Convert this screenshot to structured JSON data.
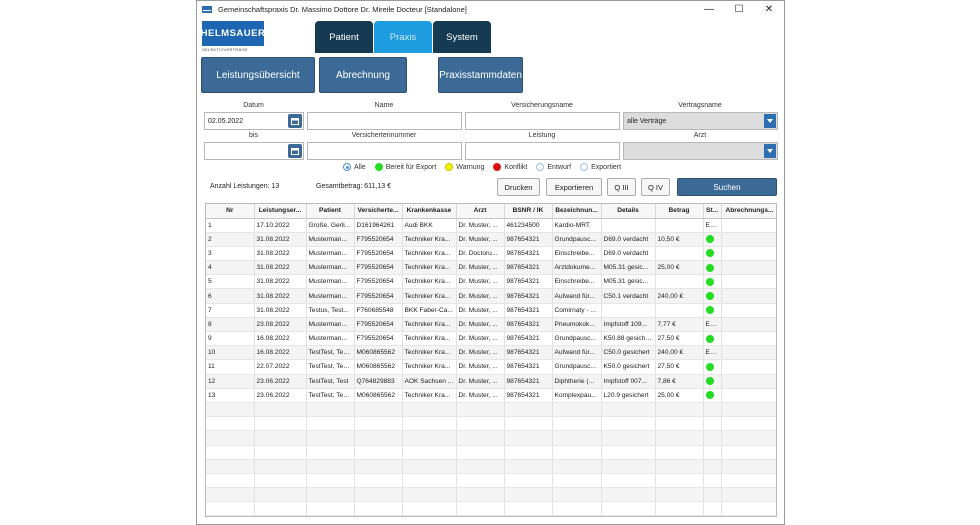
{
  "window": {
    "title": "Gemeinschaftspraxis Dr. Massimo Dottore Dr. Mireile Docteur  [Standalone]",
    "minimize": "—",
    "maximize": "☐",
    "close": "✕"
  },
  "logo": {
    "text": "HELMSAUER",
    "subtitle": "SELEKTIVVERTRÄGE"
  },
  "tabs": [
    {
      "label": "Patient"
    },
    {
      "label": "Praxis"
    },
    {
      "label": "System"
    }
  ],
  "subtabs": [
    {
      "label": "Leistungsübersicht"
    },
    {
      "label": "Abrechnung"
    },
    {
      "label": "Praxisstammdaten"
    }
  ],
  "filters": {
    "datum_label": "Datum",
    "datum_value": "02.05.2022",
    "bis_label": "bis",
    "bis_value": "",
    "name_label": "Name",
    "versichertennummer_label": "Versichertennummer",
    "versicherungsname_label": "Versicherungsname",
    "leistung_label": "Leistung",
    "vertragsname_label": "Vertragsname",
    "vertragsname_value": "alle Verträge",
    "arzt_label": "Arzt",
    "arzt_value": ""
  },
  "status_filter": {
    "options": [
      {
        "label": "Alle",
        "color": ""
      },
      {
        "label": "Bereit für Export",
        "color": "#22dd22"
      },
      {
        "label": "Warnung",
        "color": "#f2f200"
      },
      {
        "label": "Konflikt",
        "color": "#dd1111"
      },
      {
        "label": "Entwurf",
        "color": ""
      },
      {
        "label": "Exportiert",
        "color": ""
      }
    ],
    "selected": "Alle"
  },
  "summary": {
    "count": "Anzahl Leistungen: 13",
    "total": "Gesamtbetrag: 611,13 €"
  },
  "actions": {
    "drucken": "Drucken",
    "exportieren": "Exportieren",
    "q3": "Q III",
    "q4": "Q IV",
    "suchen": "Suchen"
  },
  "table": {
    "columns": [
      "Nr",
      "Leistungser...",
      "Patient",
      "Versicherte...",
      "Krankenkasse",
      "Arzt",
      "BSNR / IK",
      "Bezeichnun...",
      "Details",
      "Betrag",
      "St...",
      "Abrechnungs..."
    ],
    "rows": [
      {
        "nr": "1",
        "datum": "17.10.2022",
        "patient": "Große, Gerli...",
        "vnr": "D161964261",
        "kasse": "Audi BKK",
        "arzt": "Dr. Muster, ...",
        "bsnr": "461234500",
        "bez": "Kardio-MRT",
        "details": "",
        "betrag": "",
        "status": "En...",
        "abr": ""
      },
      {
        "nr": "2",
        "datum": "31.08.2022",
        "patient": "Musterman...",
        "vnr": "F795520654",
        "kasse": "Techniker Kra...",
        "arzt": "Dr. Muster, ...",
        "bsnr": "987654321",
        "bez": "Grundpausc...",
        "details": "D69.0 verdacht",
        "betrag": "10,50 €",
        "status": "dot",
        "abr": ""
      },
      {
        "nr": "3",
        "datum": "31.08.2022",
        "patient": "Musterman...",
        "vnr": "F795520654",
        "kasse": "Techniker Kra...",
        "arzt": "Dr. Doctoru...",
        "bsnr": "987654321",
        "bez": "Einschreibe...",
        "details": "D69.0 verdacht",
        "betrag": "",
        "status": "dot",
        "abr": ""
      },
      {
        "nr": "4",
        "datum": "31.08.2022",
        "patient": "Musterman...",
        "vnr": "F795520654",
        "kasse": "Techniker Kra...",
        "arzt": "Dr. Muster, ...",
        "bsnr": "987654321",
        "bez": "Arztdokume...",
        "details": "M05.31 gesic...",
        "betrag": "25,00 €",
        "status": "dot",
        "abr": ""
      },
      {
        "nr": "5",
        "datum": "31.08.2022",
        "patient": "Musterman...",
        "vnr": "F795520654",
        "kasse": "Techniker Kra...",
        "arzt": "Dr. Muster, ...",
        "bsnr": "987654321",
        "bez": "Einschreibe...",
        "details": "M05.31 gesic...",
        "betrag": "",
        "status": "dot",
        "abr": ""
      },
      {
        "nr": "6",
        "datum": "31.08.2022",
        "patient": "Musterman...",
        "vnr": "F795520654",
        "kasse": "Techniker Kra...",
        "arzt": "Dr. Muster, ...",
        "bsnr": "987654321",
        "bez": "Aufwand für...",
        "details": "C50.1 verdacht",
        "betrag": "240,00 €",
        "status": "dot",
        "abr": ""
      },
      {
        "nr": "7",
        "datum": "31.08.2022",
        "patient": "Testus, Test...",
        "vnr": "F760685548",
        "kasse": "BKK Faber-Ca...",
        "arzt": "Dr. Muster, ...",
        "bsnr": "987654321",
        "bez": "Comirnaty - ...",
        "details": "",
        "betrag": "",
        "status": "dot",
        "abr": ""
      },
      {
        "nr": "8",
        "datum": "23.08.2022",
        "patient": "Musterman...",
        "vnr": "F795520654",
        "kasse": "Techniker Kra...",
        "arzt": "Dr. Muster, ...",
        "bsnr": "987654321",
        "bez": "Pneumokok...",
        "details": "Impfstoff 109...",
        "betrag": "7,77 €",
        "status": "En...",
        "abr": ""
      },
      {
        "nr": "9",
        "datum": "16.08.2022",
        "patient": "Musterman...",
        "vnr": "F795520654",
        "kasse": "Techniker Kra...",
        "arzt": "Dr. Muster, ...",
        "bsnr": "987654321",
        "bez": "Grundpausc...",
        "details": "K50.88 gesichert",
        "betrag": "27,50 €",
        "status": "dot",
        "abr": ""
      },
      {
        "nr": "10",
        "datum": "16.08.2022",
        "patient": "TestTest, Tes...",
        "vnr": "M060865562",
        "kasse": "Techniker Kra...",
        "arzt": "Dr. Muster, ...",
        "bsnr": "987654321",
        "bez": "Aufwand für...",
        "details": "C50.0 gesichert",
        "betrag": "240,00 €",
        "status": "En...",
        "abr": ""
      },
      {
        "nr": "11",
        "datum": "22.07.2022",
        "patient": "TestTest, Tes...",
        "vnr": "M060865562",
        "kasse": "Techniker Kra...",
        "arzt": "Dr. Muster, ...",
        "bsnr": "987654321",
        "bez": "Grundpausc...",
        "details": "K50.0 gesichert",
        "betrag": "27,50 €",
        "status": "dot",
        "abr": ""
      },
      {
        "nr": "12",
        "datum": "23.06.2022",
        "patient": "TestTest, Test",
        "vnr": "Q764829883",
        "kasse": "AOK Sachsen ...",
        "arzt": "Dr. Muster, ...",
        "bsnr": "987654321",
        "bez": "Diphtherie (...",
        "details": "Impfstoff 007...",
        "betrag": "7,86 €",
        "status": "dot",
        "abr": ""
      },
      {
        "nr": "13",
        "datum": "23.06.2022",
        "patient": "TestTest, Tes...",
        "vnr": "M060865562",
        "kasse": "Techniker Kra...",
        "arzt": "Dr. Muster, ...",
        "bsnr": "987654321",
        "bez": "Komplexpau...",
        "details": "L20.9 gesichert",
        "betrag": "25,00 €",
        "status": "dot",
        "abr": ""
      }
    ],
    "empty_rows": 8
  }
}
